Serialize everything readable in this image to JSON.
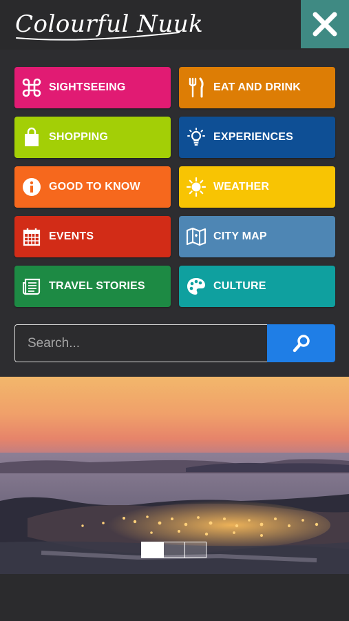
{
  "header": {
    "logo_text": "Colourful Nuuk",
    "close_icon": "close-icon",
    "close_color": "#3f8a83"
  },
  "menu": {
    "tiles": [
      {
        "label": "SIGHTSEEING",
        "icon": "command-icon",
        "color": "#e11b73"
      },
      {
        "label": "EAT AND DRINK",
        "icon": "fork-knife-icon",
        "color": "#dd7d05"
      },
      {
        "label": "SHOPPING",
        "icon": "shopping-bag-icon",
        "color": "#a3cf06"
      },
      {
        "label": "EXPERIENCES",
        "icon": "lightbulb-icon",
        "color": "#0e4f95"
      },
      {
        "label": "GOOD TO KNOW",
        "icon": "info-icon",
        "color": "#f6681d"
      },
      {
        "label": "WEATHER",
        "icon": "sun-icon",
        "color": "#f8c403"
      },
      {
        "label": "EVENTS",
        "icon": "calendar-icon",
        "color": "#d22c17"
      },
      {
        "label": "CITY MAP",
        "icon": "map-icon",
        "color": "#4e86b4"
      },
      {
        "label": "TRAVEL STORIES",
        "icon": "newspaper-icon",
        "color": "#1d8a44"
      },
      {
        "label": "CULTURE",
        "icon": "palette-icon",
        "color": "#0fa09f"
      }
    ]
  },
  "search": {
    "placeholder": "Search...",
    "value": "",
    "button_icon": "search-icon",
    "button_color": "#1f7ee6"
  },
  "hero": {
    "image": "nuuk-sunset-photo",
    "slides_total": 3,
    "active_slide": 1
  }
}
